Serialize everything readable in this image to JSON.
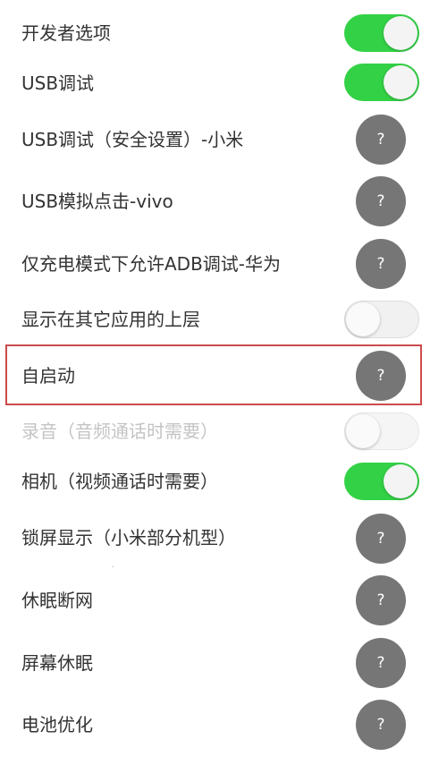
{
  "settings": [
    {
      "label": "开发者选项",
      "control": "toggle",
      "state": "on"
    },
    {
      "label": "USB调试",
      "control": "toggle",
      "state": "on"
    },
    {
      "label": "USB调试（安全设置）-小米",
      "control": "help",
      "symbol": "?"
    },
    {
      "label": "USB模拟点击-vivo",
      "control": "help",
      "symbol": "?"
    },
    {
      "label": "仅充电模式下允许ADB调试-华为",
      "control": "help",
      "symbol": "?"
    },
    {
      "label": "显示在其它应用的上层",
      "control": "toggle",
      "state": "off"
    },
    {
      "label": "自启动",
      "control": "help",
      "symbol": "?",
      "highlighted": true
    },
    {
      "label": "录音（音频通话时需要）",
      "control": "toggle",
      "state": "off",
      "disabled": true
    },
    {
      "label": "相机（视频通话时需要）",
      "control": "toggle",
      "state": "on"
    },
    {
      "label": "锁屏显示（小米部分机型）",
      "control": "help",
      "symbol": "?"
    },
    {
      "label": "休眠断网",
      "control": "help",
      "symbol": "?"
    },
    {
      "label": "屏幕休眠",
      "control": "help",
      "symbol": "?"
    },
    {
      "label": "电池优化",
      "control": "help",
      "symbol": "?"
    }
  ],
  "colors": {
    "toggle_on": "#33d246",
    "help_button": "#767676",
    "highlight_border": "#cc4b4b"
  }
}
